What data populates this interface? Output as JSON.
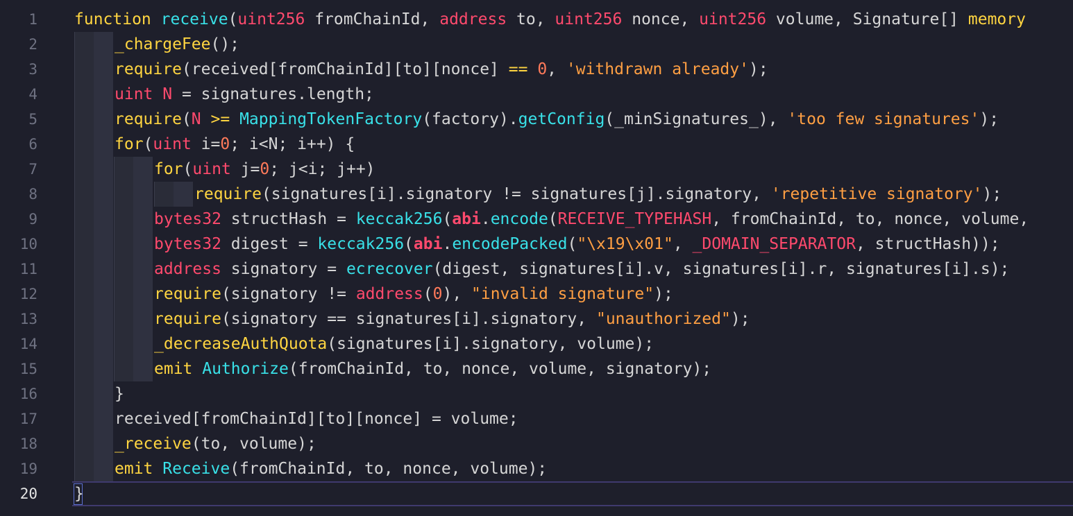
{
  "editor": {
    "faint_top_text": "...",
    "active_line": 20,
    "lines": [
      {
        "num": "1",
        "tokens": [
          [
            "k",
            "function "
          ],
          [
            "f",
            "receive"
          ],
          [
            "p",
            "("
          ],
          [
            "t",
            "uint256"
          ],
          [
            "p",
            " fromChainId, "
          ],
          [
            "t",
            "address"
          ],
          [
            "p",
            " to, "
          ],
          [
            "t",
            "uint256"
          ],
          [
            "p",
            " nonce, "
          ],
          [
            "t",
            "uint256"
          ],
          [
            "p",
            " volume, Signature[] "
          ],
          [
            "k",
            "memory"
          ]
        ]
      },
      {
        "num": "2",
        "tokens": [
          [
            "k",
            "_chargeFee"
          ],
          [
            "p",
            "();"
          ]
        ]
      },
      {
        "num": "3",
        "tokens": [
          [
            "k",
            "require"
          ],
          [
            "p",
            "(received[fromChainId][to][nonce] "
          ],
          [
            "k",
            "=="
          ],
          [
            "p",
            " "
          ],
          [
            "n",
            "0"
          ],
          [
            "p",
            ", "
          ],
          [
            "s",
            "'withdrawn already'"
          ],
          [
            "p",
            ");"
          ]
        ]
      },
      {
        "num": "4",
        "tokens": [
          [
            "t",
            "uint"
          ],
          [
            "p",
            " "
          ],
          [
            "t",
            "N"
          ],
          [
            "p",
            " = signatures.length;"
          ]
        ]
      },
      {
        "num": "5",
        "tokens": [
          [
            "k",
            "require"
          ],
          [
            "p",
            "("
          ],
          [
            "t",
            "N"
          ],
          [
            "p",
            " "
          ],
          [
            "k",
            ">="
          ],
          [
            "p",
            " "
          ],
          [
            "f",
            "MappingTokenFactory"
          ],
          [
            "p",
            "(factory)."
          ],
          [
            "f",
            "getConfig"
          ],
          [
            "p",
            "(_minSignatures_), "
          ],
          [
            "s",
            "'too few signatures'"
          ],
          [
            "p",
            ");"
          ]
        ]
      },
      {
        "num": "6",
        "tokens": [
          [
            "k",
            "for"
          ],
          [
            "p",
            "("
          ],
          [
            "t",
            "uint"
          ],
          [
            "p",
            " i="
          ],
          [
            "n",
            "0"
          ],
          [
            "p",
            "; i<N; i++) {"
          ]
        ]
      },
      {
        "num": "7",
        "tokens": [
          [
            "k",
            "for"
          ],
          [
            "p",
            "("
          ],
          [
            "t",
            "uint"
          ],
          [
            "p",
            " j="
          ],
          [
            "n",
            "0"
          ],
          [
            "p",
            "; j<i; j++)"
          ]
        ]
      },
      {
        "num": "8",
        "tokens": [
          [
            "k",
            "require"
          ],
          [
            "p",
            "(signatures[i].signatory != signatures[j].signatory, "
          ],
          [
            "s",
            "'repetitive signatory'"
          ],
          [
            "p",
            ");"
          ]
        ]
      },
      {
        "num": "9",
        "tokens": [
          [
            "t",
            "bytes32"
          ],
          [
            "p",
            " structHash = "
          ],
          [
            "f",
            "keccak256"
          ],
          [
            "p",
            "("
          ],
          [
            "r",
            "abi"
          ],
          [
            "p",
            "."
          ],
          [
            "f",
            "encode"
          ],
          [
            "p",
            "("
          ],
          [
            "t",
            "RECEIVE_TYPEHASH"
          ],
          [
            "p",
            ", fromChainId, to, nonce, volume,"
          ]
        ]
      },
      {
        "num": "10",
        "tokens": [
          [
            "t",
            "bytes32"
          ],
          [
            "p",
            " digest = "
          ],
          [
            "f",
            "keccak256"
          ],
          [
            "p",
            "("
          ],
          [
            "r",
            "abi"
          ],
          [
            "p",
            "."
          ],
          [
            "f",
            "encodePacked"
          ],
          [
            "p",
            "("
          ],
          [
            "s",
            "\"\\x19\\x01\""
          ],
          [
            "p",
            ", "
          ],
          [
            "t",
            "_DOMAIN_SEPARATOR"
          ],
          [
            "p",
            ", structHash));"
          ]
        ]
      },
      {
        "num": "11",
        "tokens": [
          [
            "t",
            "address"
          ],
          [
            "p",
            " signatory = "
          ],
          [
            "f",
            "ecrecover"
          ],
          [
            "p",
            "(digest, signatures[i].v, signatures[i].r, signatures[i].s);"
          ]
        ]
      },
      {
        "num": "12",
        "tokens": [
          [
            "k",
            "require"
          ],
          [
            "p",
            "(signatory != "
          ],
          [
            "t",
            "address"
          ],
          [
            "p",
            "("
          ],
          [
            "n",
            "0"
          ],
          [
            "p",
            "), "
          ],
          [
            "s",
            "\"invalid signature\""
          ],
          [
            "p",
            ");"
          ]
        ]
      },
      {
        "num": "13",
        "tokens": [
          [
            "k",
            "require"
          ],
          [
            "p",
            "(signatory == signatures[i].signatory, "
          ],
          [
            "s",
            "\"unauthorized\""
          ],
          [
            "p",
            ");"
          ]
        ]
      },
      {
        "num": "14",
        "tokens": [
          [
            "k",
            "_decreaseAuthQuota"
          ],
          [
            "p",
            "(signatures[i].signatory, volume);"
          ]
        ]
      },
      {
        "num": "15",
        "tokens": [
          [
            "k",
            "emit"
          ],
          [
            "p",
            " "
          ],
          [
            "f",
            "Authorize"
          ],
          [
            "p",
            "(fromChainId, to, nonce, volume, signatory);"
          ]
        ]
      },
      {
        "num": "16",
        "tokens": [
          [
            "p",
            "}"
          ]
        ]
      },
      {
        "num": "17",
        "tokens": [
          [
            "p",
            "received[fromChainId][to][nonce] = volume;"
          ]
        ]
      },
      {
        "num": "18",
        "tokens": [
          [
            "k",
            "_receive"
          ],
          [
            "p",
            "(to, volume);"
          ]
        ]
      },
      {
        "num": "19",
        "tokens": [
          [
            "k",
            "emit"
          ],
          [
            "p",
            " "
          ],
          [
            "f",
            "Receive"
          ],
          [
            "p",
            "(fromChainId, to, nonce, volume);"
          ]
        ]
      },
      {
        "num": "20",
        "tokens": [
          [
            "p",
            "}"
          ]
        ]
      }
    ]
  }
}
